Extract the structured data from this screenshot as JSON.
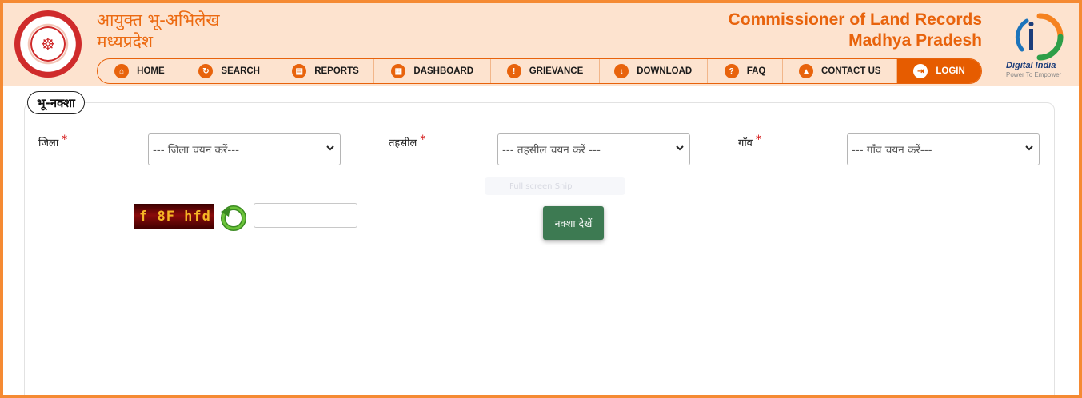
{
  "header": {
    "title_hi_line1": "आयुक्त भू-अभिलेख",
    "title_hi_line2": "मध्यप्रदेश",
    "title_en_line1": "Commissioner of Land Records",
    "title_en_line2": "Madhya Pradesh",
    "logo_text": "Digital India",
    "logo_tagline": "Power To Empower"
  },
  "nav": {
    "items": [
      {
        "label": "HOME",
        "icon": "home-icon"
      },
      {
        "label": "SEARCH",
        "icon": "refresh-search-icon"
      },
      {
        "label": "REPORTS",
        "icon": "report-icon"
      },
      {
        "label": "DASHBOARD",
        "icon": "dashboard-icon"
      },
      {
        "label": "GRIEVANCE",
        "icon": "grievance-icon"
      },
      {
        "label": "DOWNLOAD",
        "icon": "download-icon"
      },
      {
        "label": "FAQ",
        "icon": "faq-icon"
      },
      {
        "label": "CONTACT US",
        "icon": "contact-icon"
      },
      {
        "label": "LOGIN",
        "icon": "login-icon"
      }
    ],
    "active": "LOGIN"
  },
  "form": {
    "legend": "भू-नक्शा",
    "district_label": "जिला",
    "district_placeholder": "--- जिला चयन करें---",
    "tehsil_label": "तहसील",
    "tehsil_placeholder": "--- तहसील चयन करें ---",
    "village_label": "गाँव",
    "village_placeholder": "--- गाँव चयन करें---",
    "required_mark": "*",
    "captcha_text": "f 8F hfd",
    "captcha_input_value": "",
    "submit_label": "नक्शा देखें",
    "tooltip_text": "Full screen Snip"
  },
  "colors": {
    "accent": "#e8630c",
    "header_bg": "#fde3cf",
    "button_green": "#3d7a52",
    "border_orange": "#f58a33"
  }
}
